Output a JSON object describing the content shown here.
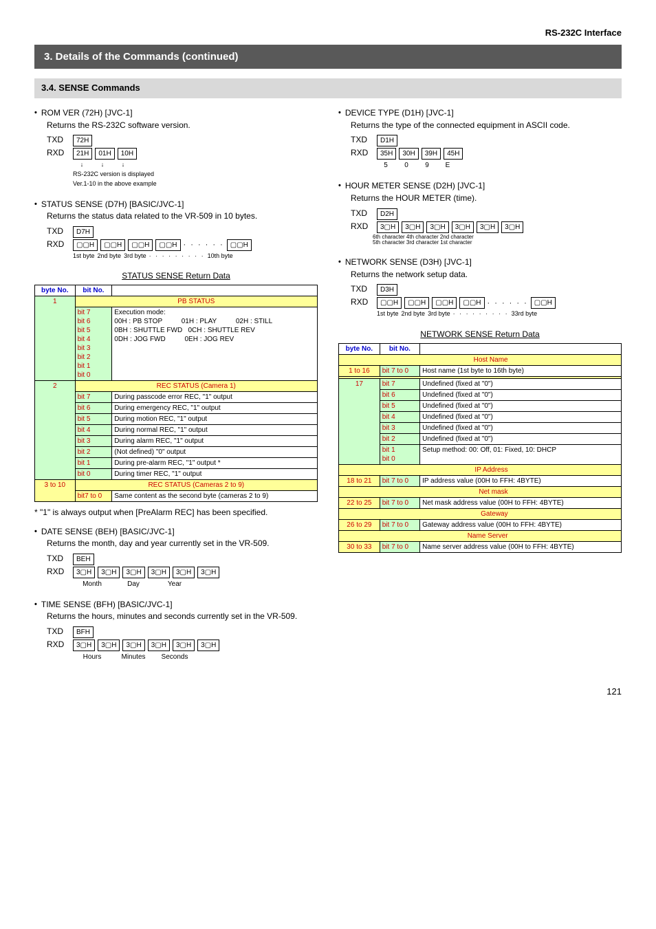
{
  "header": {
    "interface": "RS-232C Interface"
  },
  "title_bar": "3. Details of the Commands (continued)",
  "sub_bar": "3.4. SENSE Commands",
  "left": {
    "rom_ver": {
      "title": "ROM VER (72H) [JVC-1]",
      "desc": "Returns the RS-232C software version.",
      "txd": "TXD",
      "txd_box": "72H",
      "rxd": "RXD",
      "rxd_boxes": [
        "21H",
        "01H",
        "10H"
      ],
      "note1": "RS-232C version is displayed",
      "note2": "Ver.1-10 in the above example"
    },
    "status_sense": {
      "title": "STATUS SENSE (D7H) [BASIC/JVC-1]",
      "desc": "Returns the status data related to the VR-509 in 10 bytes.",
      "txd": "TXD",
      "txd_box": "D7H",
      "rxd": "RXD",
      "byte_labels": [
        "1st byte",
        "2nd byte",
        "3rd byte",
        "",
        "",
        "10th byte"
      ]
    },
    "status_table_title": "STATUS SENSE Return Data",
    "status_table": {
      "hdr_byte": "byte No.",
      "hdr_bit": "bit No.",
      "pb_status": "PB STATUS",
      "row1_byte": "1",
      "row1_bits": [
        "bit 7",
        "bit 6",
        "bit 5",
        "bit 4",
        "bit 3",
        "bit 2",
        "bit 1",
        "bit 0"
      ],
      "row1_text": "Execution mode:\n00H : PB STOP          01H : PLAY          02H : STILL\n0BH : SHUTTLE FWD   0CH : SHUTTLE REV\n0DH : JOG FWD          0EH : JOG REV",
      "rec_status1": "REC STATUS (Camera 1)",
      "row2_byte": "2",
      "row2": [
        {
          "bit": "bit 7",
          "txt": "During passcode error REC, \"1\" output"
        },
        {
          "bit": "bit 6",
          "txt": "During emergency REC, \"1\" output"
        },
        {
          "bit": "bit 5",
          "txt": "During motion REC, \"1\" output"
        },
        {
          "bit": "bit 4",
          "txt": "During normal REC, \"1\" output"
        },
        {
          "bit": "bit 3",
          "txt": "During alarm REC, \"1\" output"
        },
        {
          "bit": "bit 2",
          "txt": "(Not defined) \"0\" output"
        },
        {
          "bit": "bit 1",
          "txt": "During pre-alarm REC, \"1\" output *"
        },
        {
          "bit": "bit 0",
          "txt": "During timer REC, \"1\" output"
        }
      ],
      "rec_status29": "REC STATUS (Cameras 2 to 9)",
      "row3_byte": "3 to 10",
      "row3_bit": "bit7 to 0",
      "row3_txt": "Same content as the second byte (cameras 2 to 9)"
    },
    "footnote": "*   \"1\" is always output when [PreAlarm REC] has been specified.",
    "date_sense": {
      "title": "DATE SENSE (BEH) [BASIC/JVC-1]",
      "desc": "Returns the month, day and year currently set in the VR-509.",
      "txd": "TXD",
      "txd_box": "BEH",
      "rxd": "RXD",
      "labels": [
        "Month",
        "Day",
        "Year"
      ]
    },
    "time_sense": {
      "title": "TIME SENSE (BFH) [BASIC/JVC-1]",
      "desc": "Returns the hours, minutes and seconds currently set in the VR-509.",
      "txd": "TXD",
      "txd_box": "BFH",
      "rxd": "RXD",
      "labels": [
        "Hours",
        "Minutes",
        "Seconds"
      ]
    }
  },
  "right": {
    "device_type": {
      "title": "DEVICE TYPE (D1H) [JVC-1]",
      "desc": "Returns the type of the connected equipment in ASCII code.",
      "txd": "TXD",
      "txd_box": "D1H",
      "rxd": "RXD",
      "boxes": [
        "35H",
        "30H",
        "39H",
        "45H"
      ],
      "chars": [
        "5",
        "0",
        "9",
        "E"
      ]
    },
    "hour_meter": {
      "title": "HOUR METER SENSE (D2H) [JVC-1]",
      "desc": "Returns the HOUR METER (time).",
      "txd": "TXD",
      "txd_box": "D2H",
      "rxd": "RXD",
      "char_note1": "6th character   4th character   2nd character",
      "char_note2": "5th character   3rd character   1st character"
    },
    "network_sense": {
      "title": "NETWORK SENSE (D3H) [JVC-1]",
      "desc": "Returns the network setup data.",
      "txd": "TXD",
      "txd_box": "D3H",
      "rxd": "RXD",
      "byte_labels": [
        "1st byte",
        "2nd byte",
        "3rd byte",
        "",
        "",
        "33rd byte"
      ]
    },
    "network_table_title": "NETWORK SENSE Return Data",
    "network_table": {
      "hdr_byte": "byte No.",
      "hdr_bit": "bit No.",
      "host_name": "Host Name",
      "r1_byte": "1 to 16",
      "r1_bit": "bit 7 to 0",
      "r1_txt": "Host name (1st byte to 16th byte)",
      "r17_byte": "17",
      "r17": [
        {
          "bit": "bit 7",
          "txt": "Undefined (fixed at \"0\")"
        },
        {
          "bit": "bit 6",
          "txt": "Undefined (fixed at \"0\")"
        },
        {
          "bit": "bit 5",
          "txt": "Undefined (fixed at \"0\")"
        },
        {
          "bit": "bit 4",
          "txt": "Undefined (fixed at \"0\")"
        },
        {
          "bit": "bit 3",
          "txt": "Undefined (fixed at \"0\")"
        },
        {
          "bit": "bit 2",
          "txt": "Undefined (fixed at \"0\")"
        }
      ],
      "r17_setup_bits": "bit 1\nbit 0",
      "r17_setup": "Setup method: 00: Off, 01: Fixed, 10: DHCP",
      "ip_addr": "IP Address",
      "r18_byte": "18 to 21",
      "r18_bit": "bit 7 to 0",
      "r18_txt": "IP address value (00H to FFH: 4BYTE)",
      "net_mask": "Net mask",
      "r22_byte": "22 to 25",
      "r22_bit": "bit 7 to 0",
      "r22_txt": "Net mask address value (00H to FFH: 4BYTE)",
      "gateway": "Gateway",
      "r26_byte": "26 to 29",
      "r26_bit": "bit 7 to 0",
      "r26_txt": "Gateway address value (00H to FFH: 4BYTE)",
      "name_server": "Name Server",
      "r30_byte": "30 to 33",
      "r30_bit": "bit 7 to 0",
      "r30_txt": "Name server address value (00H to FFH: 4BYTE)"
    }
  },
  "page_number": "121"
}
